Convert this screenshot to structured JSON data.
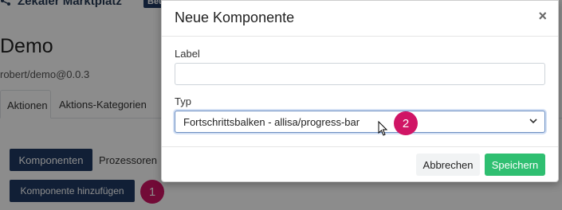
{
  "background": {
    "app_title": "Zekaler Marktplatz",
    "app_badge": "Beta",
    "page_title": "Demo",
    "package_id": "robert/demo@0.0.3",
    "tabs": [
      {
        "label": "Aktionen"
      },
      {
        "label": "Aktions-Kategorien"
      }
    ],
    "komponenten_button": "Komponenten",
    "prozessoren_link": "Prozessoren",
    "add_component_button": "Komponente hinzufügen",
    "step_marker_1": "1"
  },
  "modal": {
    "title": "Neue Komponente",
    "close_symbol": "×",
    "label_field": {
      "label": "Label",
      "value": "",
      "placeholder": ""
    },
    "type_field": {
      "label": "Typ",
      "selected": "Fortschrittsbalken - allisa/progress-bar"
    },
    "step_marker_2": "2",
    "cancel_button": "Abbrechen",
    "save_button": "Speichern"
  },
  "colors": {
    "primary_dark": "#1f3a63",
    "marker": "#d01565",
    "save": "#2fbf71"
  }
}
